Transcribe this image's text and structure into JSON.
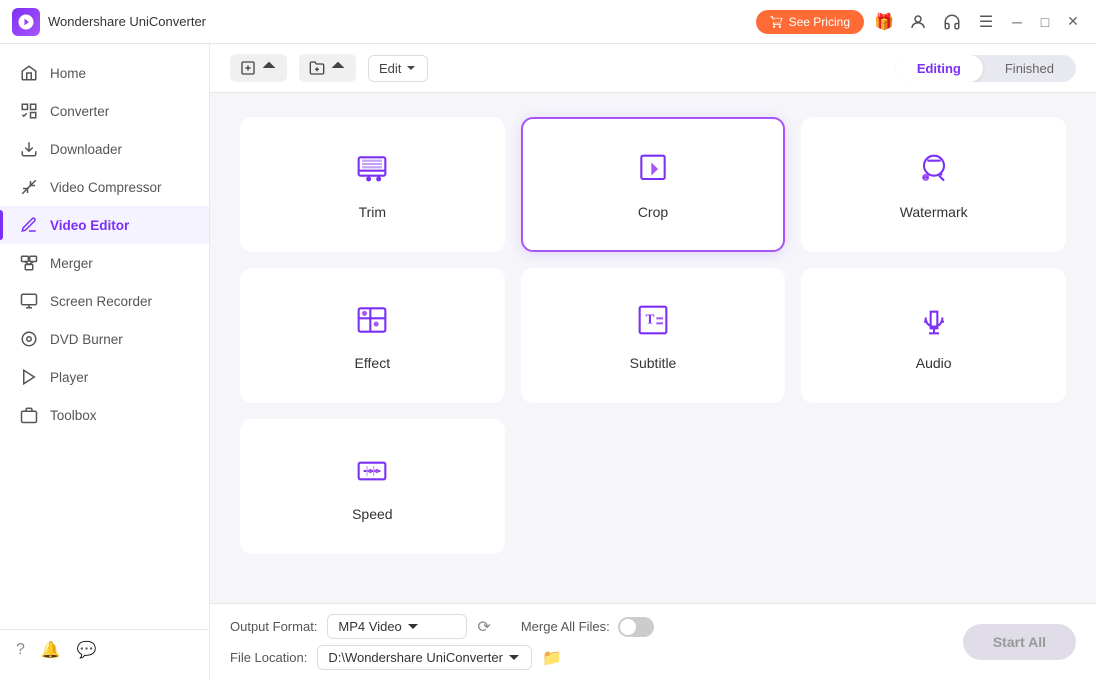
{
  "titleBar": {
    "appName": "Wondershare UniConverter",
    "seePricingLabel": "See Pricing"
  },
  "sidebar": {
    "items": [
      {
        "id": "home",
        "label": "Home",
        "active": false
      },
      {
        "id": "converter",
        "label": "Converter",
        "active": false
      },
      {
        "id": "downloader",
        "label": "Downloader",
        "active": false
      },
      {
        "id": "video-compressor",
        "label": "Video Compressor",
        "active": false
      },
      {
        "id": "video-editor",
        "label": "Video Editor",
        "active": true
      },
      {
        "id": "merger",
        "label": "Merger",
        "active": false
      },
      {
        "id": "screen-recorder",
        "label": "Screen Recorder",
        "active": false
      },
      {
        "id": "dvd-burner",
        "label": "DVD Burner",
        "active": false
      },
      {
        "id": "player",
        "label": "Player",
        "active": false
      },
      {
        "id": "toolbox",
        "label": "Toolbox",
        "active": false
      }
    ]
  },
  "toolbar": {
    "editLabel": "Edit",
    "editingTab": "Editing",
    "finishedTab": "Finished"
  },
  "editorCards": [
    {
      "id": "trim",
      "label": "Trim",
      "highlighted": false
    },
    {
      "id": "crop",
      "label": "Crop",
      "highlighted": true
    },
    {
      "id": "watermark",
      "label": "Watermark",
      "highlighted": false
    },
    {
      "id": "effect",
      "label": "Effect",
      "highlighted": false
    },
    {
      "id": "subtitle",
      "label": "Subtitle",
      "highlighted": false
    },
    {
      "id": "audio",
      "label": "Audio",
      "highlighted": false
    },
    {
      "id": "speed",
      "label": "Speed",
      "highlighted": false
    }
  ],
  "bottomBar": {
    "outputFormatLabel": "Output Format:",
    "outputFormatValue": "MP4 Video",
    "mergeAllLabel": "Merge All Files:",
    "fileLocationLabel": "File Location:",
    "fileLocationValue": "D:\\Wondershare UniConverter",
    "startAllLabel": "Start All"
  }
}
